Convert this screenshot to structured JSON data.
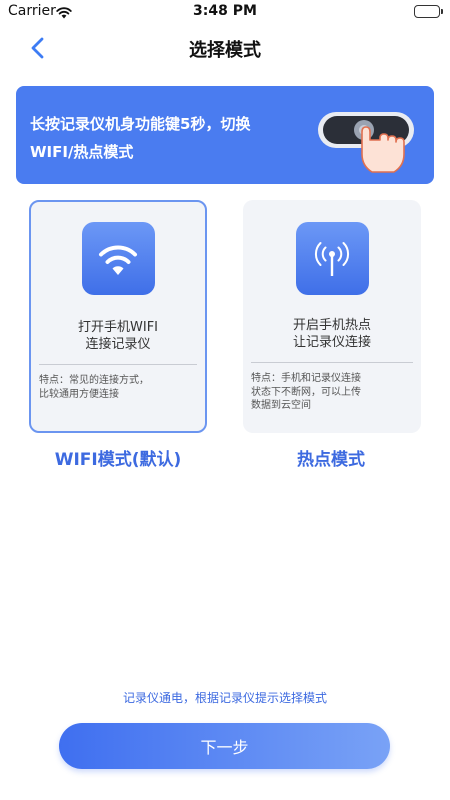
{
  "status_bar": {
    "carrier": "Carrier",
    "time": "3:48 PM"
  },
  "nav": {
    "title": "选择模式"
  },
  "banner": {
    "text_line1": "长按记录仪机身功能键5秒，切换",
    "text_line2": "WIFI/热点模式"
  },
  "cards": [
    {
      "mode_label": "WIFI模式(默认)",
      "title_line1": "打开手机WIFI",
      "title_line2": "连接记录仪",
      "feature_line1": "特点：常见的连接方式，",
      "feature_line2": "比较通用方便连接",
      "feature_line3": "",
      "icon": "wifi-icon",
      "selected": true
    },
    {
      "mode_label": "热点模式",
      "title_line1": "开启手机热点",
      "title_line2": "让记录仪连接",
      "feature_line1": "特点：手机和记录仪连接",
      "feature_line2": "状态下不断网，可以上传",
      "feature_line3": "数据到云空间",
      "icon": "hotspot-antenna-icon",
      "selected": false
    }
  ],
  "hint": "记录仪通电，根据记录仪提示选择模式",
  "next_button": "下一步",
  "colors": {
    "accent": "#3d6ae0",
    "banner": "#4a7cf0",
    "card_bg": "#f2f4f8"
  }
}
